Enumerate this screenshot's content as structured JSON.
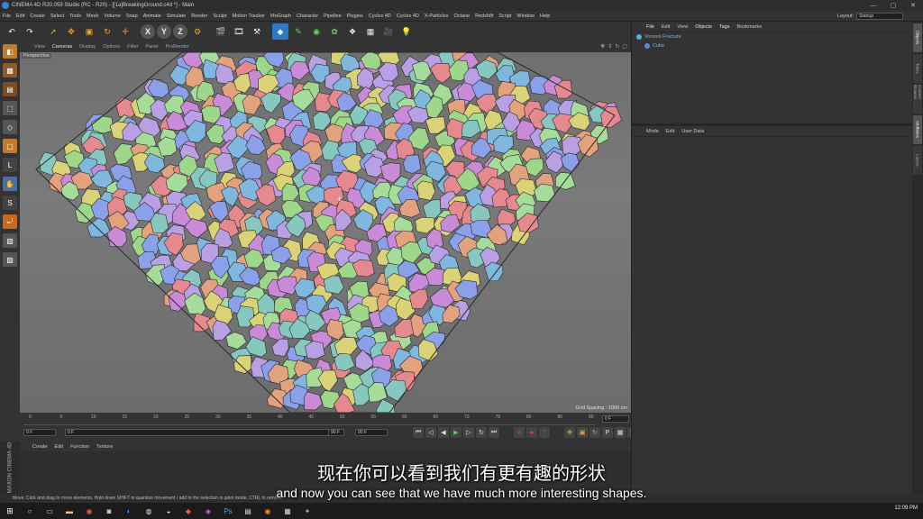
{
  "window": {
    "title": "CINEMA 4D R20.059 Studio (RC - R20) - [[1a]BreakingGround.c4d *] - Main",
    "controls": [
      "—",
      "▢",
      "✕"
    ]
  },
  "menubar": {
    "items": [
      "File",
      "Edit",
      "Create",
      "Select",
      "Tools",
      "Mesh",
      "Volume",
      "Snap",
      "Animate",
      "Simulate",
      "Render",
      "Sculpt",
      "Motion Tracker",
      "MoGraph",
      "Character",
      "Pipeline",
      "Plugins",
      "Cycles 4D",
      "Cycles 4D",
      "X-Particles",
      "Octane",
      "Redshift",
      "Script",
      "Window",
      "Help"
    ],
    "layout_label": "Layout:",
    "layout_value": "Startup"
  },
  "viewport": {
    "menu": [
      "View",
      "Cameras",
      "Display",
      "Options",
      "Filter",
      "Panel",
      "ProRender"
    ],
    "camera_label": "Perspective",
    "grid_spacing": "Grid Spacing : 1000 cm",
    "colors": [
      "#c98bd8",
      "#8aa0e8",
      "#86c8c0",
      "#e2a27e",
      "#9ed68a",
      "#d9d276",
      "#e6898f",
      "#7fb7df",
      "#b9a0e4",
      "#a6dc9a"
    ]
  },
  "timeline": {
    "ticks": [
      "0",
      "5",
      "10",
      "15",
      "20",
      "25",
      "30",
      "35",
      "40",
      "45",
      "50",
      "55",
      "60",
      "65",
      "70",
      "75",
      "80",
      "85",
      "90"
    ],
    "current_frame": "0 F",
    "start_frame": "0 F",
    "field_a": "0 F",
    "end_frame_a": "90 F",
    "end_frame_b": "90 F"
  },
  "material": {
    "menu": [
      "Create",
      "Edit",
      "Function",
      "Texture"
    ]
  },
  "objects": {
    "menu": [
      "File",
      "Edit",
      "View",
      "Objects",
      "Tags",
      "Bookmarks"
    ],
    "items": [
      {
        "label": "Voronoi Fracture",
        "color": "#4fb0d8"
      },
      {
        "label": "Cube",
        "color": "#4f8fd8"
      }
    ]
  },
  "attributes": {
    "menu": [
      "Mode",
      "Edit",
      "User Data"
    ]
  },
  "side_tabs": [
    "Objects",
    "Takes",
    "Content Browser",
    "Attributes",
    "Layers"
  ],
  "status": {
    "text": "Move: Click and drag to move elements. Hold down SHIFT to quantize movement / add to the selection in point mode, CTRL to remove."
  },
  "branding": {
    "text": "MAXON CINEMA 4D"
  },
  "subtitles": {
    "chinese": "现在你可以看到我们有更有趣的形状",
    "english": "and now you can see that we have much more interesting shapes."
  },
  "taskbar": {
    "clock": "12:09 PM"
  }
}
